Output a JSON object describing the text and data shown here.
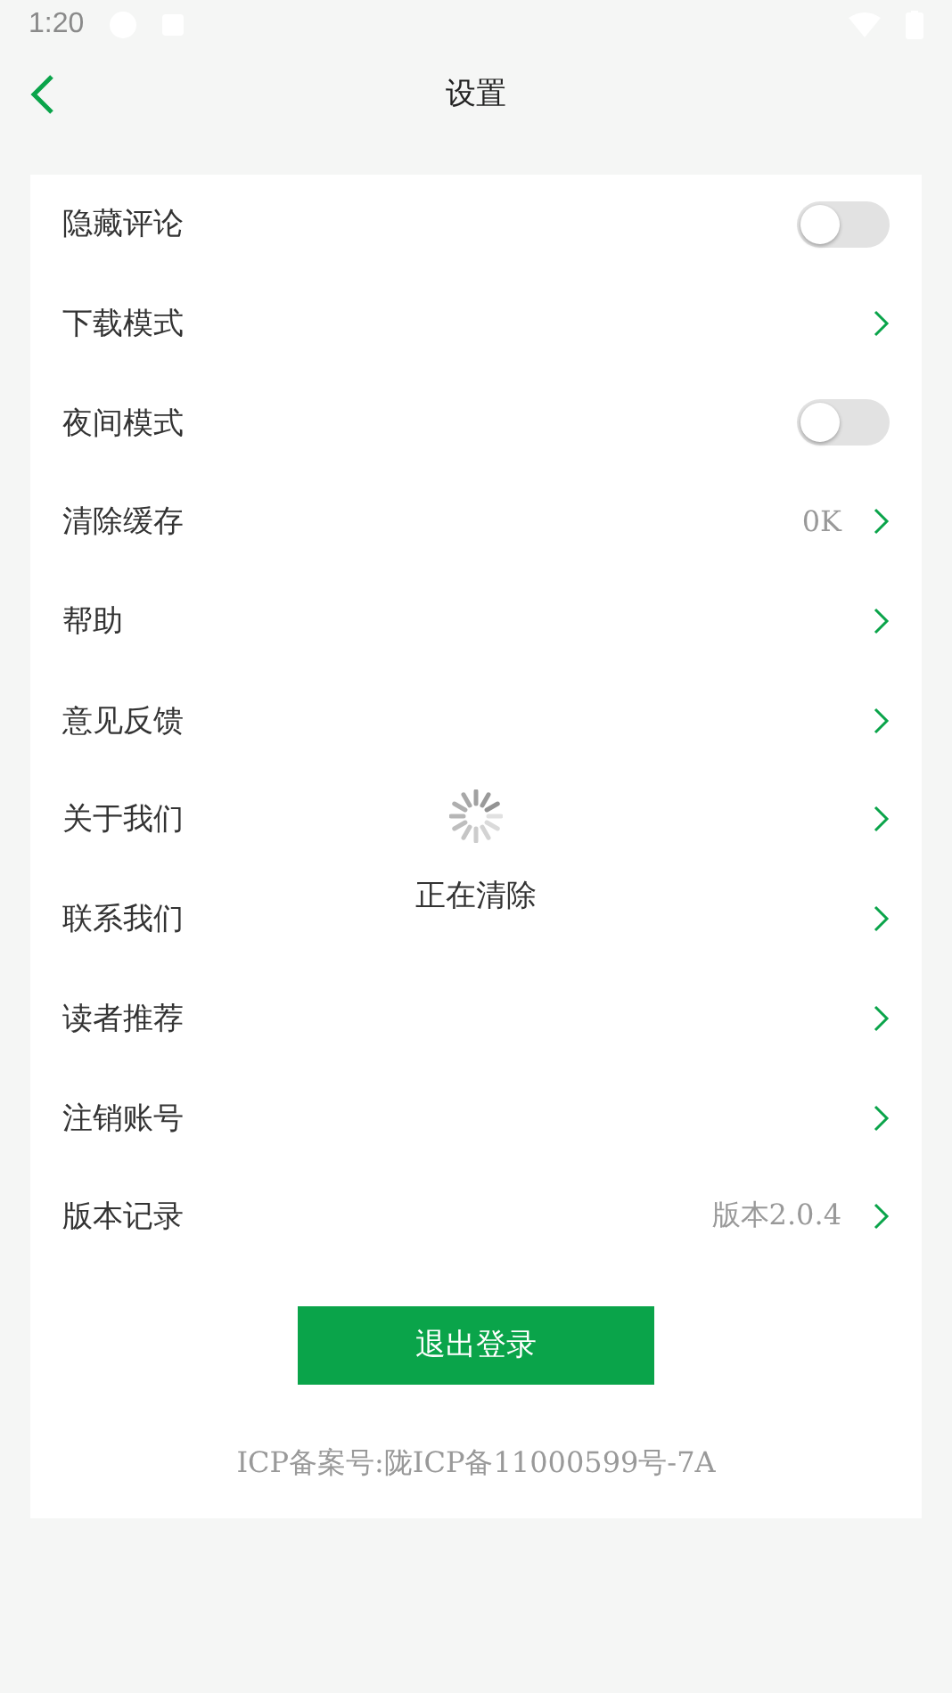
{
  "status_bar": {
    "time": "1:20"
  },
  "header": {
    "title": "设置"
  },
  "settings": [
    {
      "kind": "toggle",
      "label": "隐藏评论",
      "on": false
    },
    {
      "kind": "link",
      "label": "下载模式"
    },
    {
      "kind": "toggle",
      "label": "夜间模式",
      "on": false
    },
    {
      "kind": "link",
      "label": "清除缓存",
      "value": "0K"
    },
    {
      "kind": "link",
      "label": "帮助"
    },
    {
      "kind": "link",
      "label": "意见反馈"
    },
    {
      "kind": "link",
      "label": "关于我们"
    },
    {
      "kind": "link",
      "label": "联系我们"
    },
    {
      "kind": "link",
      "label": "读者推荐"
    },
    {
      "kind": "link",
      "label": "注销账号"
    },
    {
      "kind": "link",
      "label": "版本记录",
      "value": "版本2.0.4"
    }
  ],
  "logout_button": "退出登录",
  "icp": "ICP备案号:陇ICP备11000599号-7A",
  "loading": {
    "text": "正在清除"
  }
}
